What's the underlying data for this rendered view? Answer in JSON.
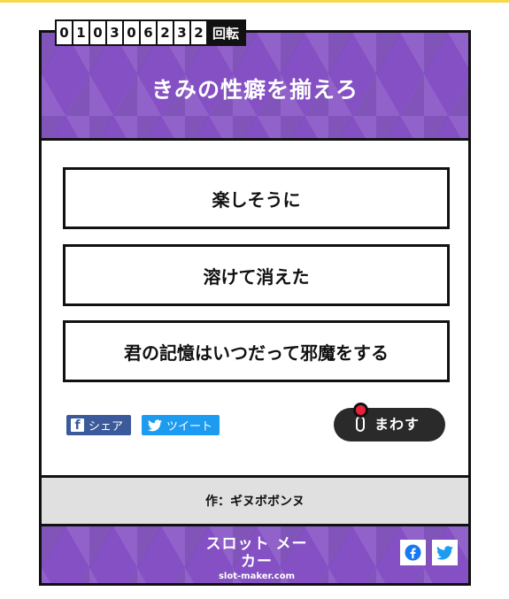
{
  "counter": {
    "digits": [
      "0",
      "1",
      "0",
      "3",
      "0",
      "6",
      "2",
      "3",
      "2"
    ],
    "unit": "回転"
  },
  "header": {
    "title": "きみの性癖を揃えろ"
  },
  "reels": [
    "楽しそうに",
    "溶けて消えた",
    "君の記憶はいつだって邪魔をする"
  ],
  "share": {
    "facebook_label": "シェア",
    "twitter_label": "ツイート"
  },
  "spin": {
    "label": "まわす"
  },
  "author": {
    "text": "作：ギヌボボンヌ"
  },
  "footer": {
    "logo_main": "スロット メーカー",
    "logo_sub": "slot-maker.com"
  },
  "colors": {
    "header_purple": "#8450c4",
    "facebook_blue": "#3b5a9b",
    "twitter_blue": "#1d9bf0",
    "spin_red": "#e8213d",
    "author_bar_gray": "#e0e0e0"
  },
  "icons": [
    "facebook-icon",
    "twitter-bird-icon",
    "lever-icon"
  ]
}
